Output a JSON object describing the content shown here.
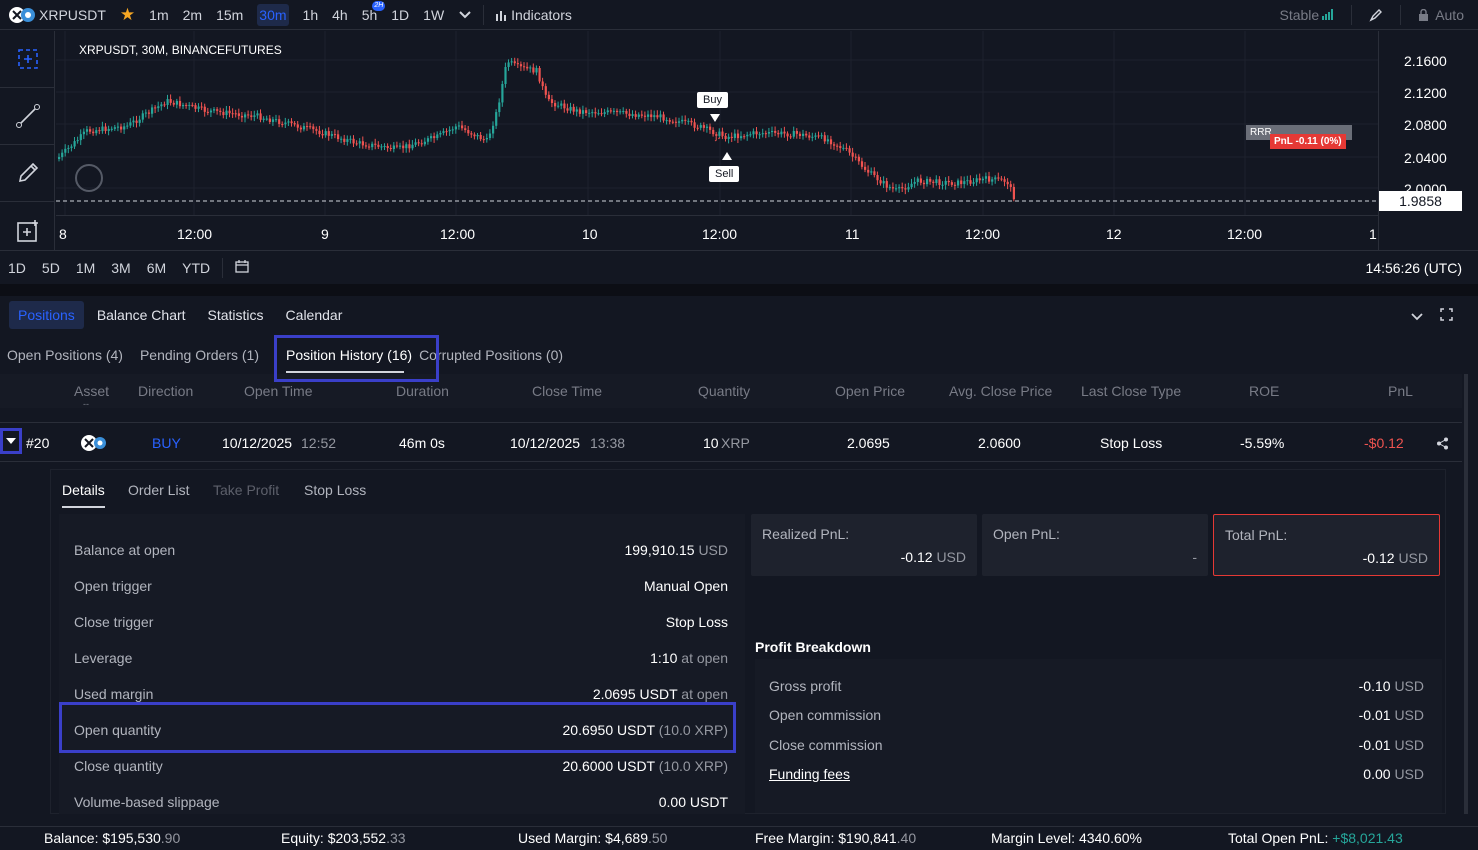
{
  "topbar": {
    "symbol": "XRPUSDT",
    "intervals": [
      "1m",
      "2m",
      "15m",
      "30m",
      "1h",
      "4h",
      "5h",
      "1D",
      "1W"
    ],
    "active_interval": "30m",
    "badge_5h": "2H",
    "indicators_label": "Indicators",
    "stable_label": "Stable",
    "auto_label": "Auto"
  },
  "chart": {
    "legend": "XRPUSDT, 30M, BINANCEFUTURES",
    "buy_label": "Buy",
    "sell_label": "Sell",
    "rrr_label": "RRR",
    "pnl_label": "PnL -0.11 (0%)",
    "price_ticks": [
      "2.1600",
      "2.1200",
      "2.0800",
      "2.0400",
      "2.0000"
    ],
    "current_price": "1.9858",
    "time_ticks": [
      "8",
      "12:00",
      "9",
      "12:00",
      "10",
      "12:00",
      "11",
      "12:00",
      "12",
      "12:00",
      "1"
    ],
    "colors": {
      "up": "#26a69a",
      "down": "#ef5350",
      "bg": "#131722"
    }
  },
  "rangebar": {
    "ranges": [
      "1D",
      "5D",
      "1M",
      "3M",
      "6M",
      "YTD"
    ],
    "clock": "14:56:26 (UTC)"
  },
  "main_tabs": [
    "Positions",
    "Balance Chart",
    "Statistics",
    "Calendar"
  ],
  "sub_tabs": [
    "Open Positions (4)",
    "Pending Orders (1)",
    "Position History (16)",
    "Corrupted Positions (0)"
  ],
  "columns": [
    "Asset",
    "Direction",
    "Open Time",
    "Duration",
    "Close Time",
    "Quantity",
    "Open Price",
    "Avg. Close Price",
    "Last Close Type",
    "ROE",
    "PnL"
  ],
  "column_sub": "--",
  "row": {
    "id": "#20",
    "direction": "BUY",
    "open_date": "10/12/2025",
    "open_time": "12:52",
    "duration": "46m 0s",
    "close_date": "10/12/2025",
    "close_time": "13:38",
    "qty": "10",
    "qty_unit": "XRP",
    "open_price": "2.0695",
    "avg_close": "2.0600",
    "close_type": "Stop Loss",
    "roe": "-5.59%",
    "pnl": "-$0.12"
  },
  "detail_tabs": [
    "Details",
    "Order List",
    "Take Profit",
    "Stop Loss"
  ],
  "details": [
    {
      "label": "Balance at open",
      "value": "199,910.15",
      "unit": "USD"
    },
    {
      "label": "Open trigger",
      "value": "Manual Open",
      "unit": ""
    },
    {
      "label": "Close trigger",
      "value": "Stop Loss",
      "unit": ""
    },
    {
      "label": "Leverage",
      "value": "1:10",
      "unit": "at open"
    },
    {
      "label": "Used margin",
      "value": "2.0695 USDT",
      "unit": "at open"
    },
    {
      "label": "Open quantity",
      "value": "20.6950 USDT",
      "unit": "(10.0 XRP)"
    },
    {
      "label": "Close quantity",
      "value": "20.6000 USDT",
      "unit": "(10.0 XRP)"
    },
    {
      "label": "Volume-based slippage",
      "value": "0.00 USDT",
      "unit": ""
    }
  ],
  "cards": {
    "realized": {
      "label": "Realized PnL:",
      "value": "-0.12",
      "unit": "USD"
    },
    "open": {
      "label": "Open PnL:",
      "value": "-"
    },
    "total": {
      "label": "Total PnL:",
      "value": "-0.12",
      "unit": "USD"
    }
  },
  "profit_breakdown": {
    "title": "Profit Breakdown",
    "rows": [
      {
        "label": "Gross profit",
        "value": "-0.10",
        "unit": "USD"
      },
      {
        "label": "Open commission",
        "value": "-0.01",
        "unit": "USD"
      },
      {
        "label": "Close commission",
        "value": "-0.01",
        "unit": "USD"
      },
      {
        "label": "Funding fees",
        "value": "0.00",
        "unit": "USD"
      }
    ]
  },
  "status": {
    "balance_label": "Balance:",
    "balance": "$195,530",
    "balance_dec": ".90",
    "equity_label": "Equity:",
    "equity": "$203,552",
    "equity_dec": ".33",
    "used_label": "Used Margin:",
    "used": "$4,689",
    "used_dec": ".50",
    "free_label": "Free Margin:",
    "free": "$190,841",
    "free_dec": ".40",
    "level_label": "Margin Level:",
    "level": "4340.60%",
    "top_label": "Total Open PnL:",
    "top": "+$8,021.43"
  }
}
